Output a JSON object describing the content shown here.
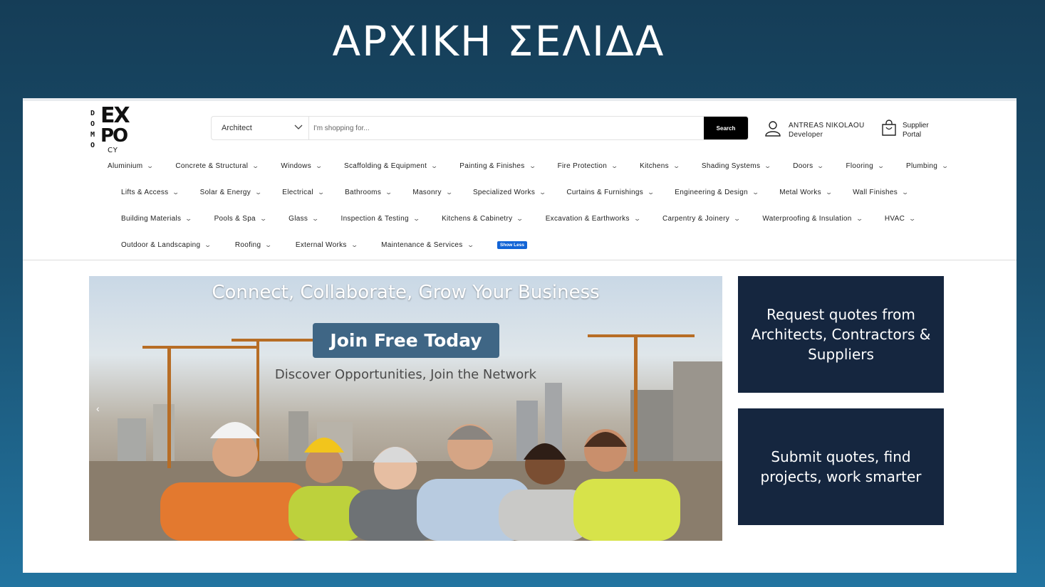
{
  "slide": {
    "title": "ΑΡΧΙΚΗ ΣΕΛΙΔΑ"
  },
  "logo": {
    "side_letters": "D\nO\nM\nO",
    "line1": "EX",
    "line2": "PO",
    "line3": "CY"
  },
  "search": {
    "category": "Architect",
    "placeholder": "I'm shopping for...",
    "button": "Search"
  },
  "user": {
    "name": "ANTREAS NIKOLAOU",
    "role": "Developer",
    "icon": "user-icon"
  },
  "supplier": {
    "line1": "Supplier",
    "line2": "Portal",
    "icon": "shopping-bag-icon"
  },
  "nav": {
    "row1": [
      "Aluminium",
      "Concrete & Structural",
      "Windows",
      "Scaffolding & Equipment",
      "Painting & Finishes",
      "Fire Protection",
      "Kitchens",
      "Shading Systems",
      "Doors",
      "Flooring",
      "Plumbing"
    ],
    "row2": [
      "Lifts & Access",
      "Solar & Energy",
      "Electrical",
      "Bathrooms",
      "Masonry",
      "Specialized Works",
      "Curtains & Furnishings",
      "Engineering & Design",
      "Metal Works",
      "Wall Finishes"
    ],
    "row3": [
      "Building Materials",
      "Pools & Spa",
      "Glass",
      "Inspection & Testing",
      "Kitchens & Cabinetry",
      "Excavation & Earthworks",
      "Carpentry & Joinery",
      "Waterproofing & Insulation",
      "HVAC"
    ],
    "row4": [
      "Outdoor & Landscaping",
      "Roofing",
      "External Works",
      "Maintenance & Services"
    ],
    "show_less": "Show Less"
  },
  "hero": {
    "title": "Connect, Collaborate, Grow Your Business",
    "button": "Join Free Today",
    "subtitle": "Discover Opportunities, Join the Network",
    "prev": "‹"
  },
  "cards": {
    "card1": "Request quotes from Architects, Contractors & Suppliers",
    "card2": "Submit quotes, find projects, work smarter"
  },
  "colors": {
    "accent": "#1264d6",
    "card_bg": "#15263f",
    "join_button": "#3f6685"
  }
}
